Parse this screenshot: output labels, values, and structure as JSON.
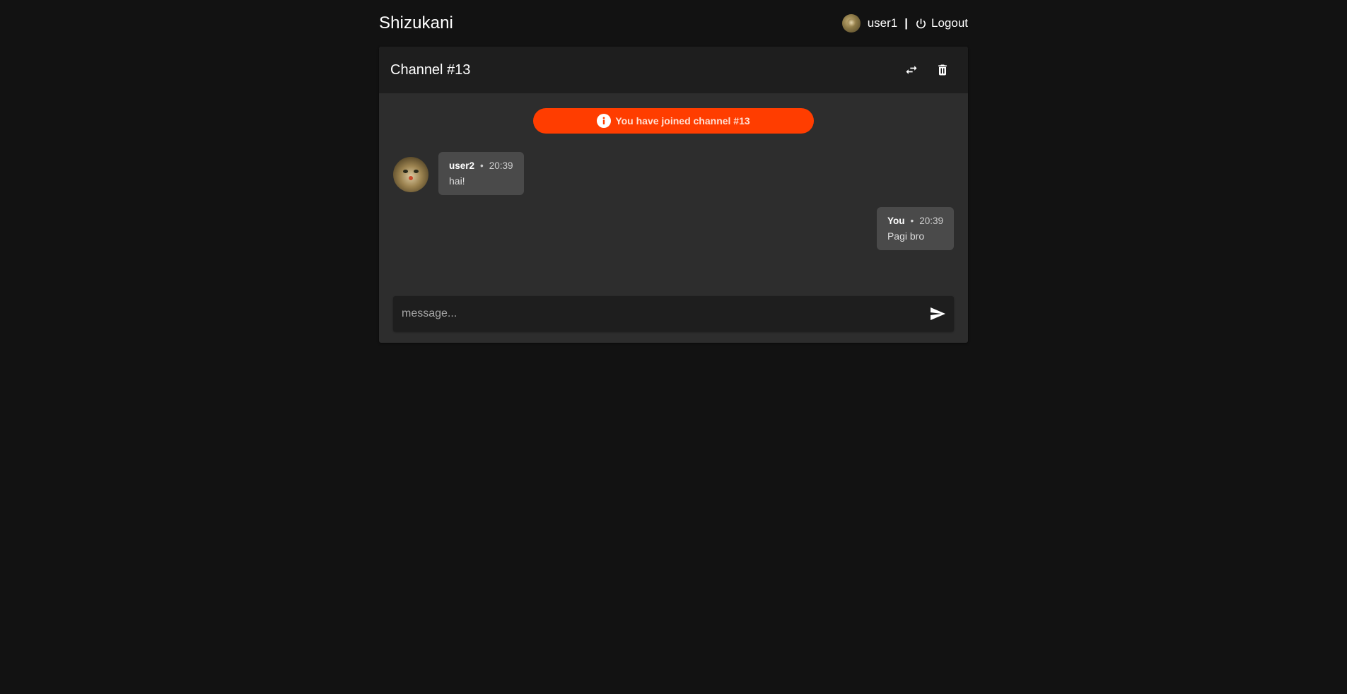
{
  "app": {
    "brand": "Shizukani"
  },
  "user": {
    "username": "user1",
    "divider": "|",
    "logout_label": "Logout"
  },
  "channel": {
    "title": "Channel #13"
  },
  "notice": {
    "text": "You have joined channel #13",
    "color": "#ff3d00"
  },
  "messages": [
    {
      "author": "user2",
      "separator": "•",
      "time": "20:39",
      "text": "hai!"
    },
    {
      "author": "You",
      "separator": "•",
      "time": "20:39",
      "text": "Pagi bro"
    }
  ],
  "composer": {
    "placeholder": "message..."
  },
  "icons": {
    "swap": "swap-horiz-icon",
    "delete": "trash-icon",
    "send": "send-icon",
    "info": "info-icon",
    "power": "power-icon"
  }
}
